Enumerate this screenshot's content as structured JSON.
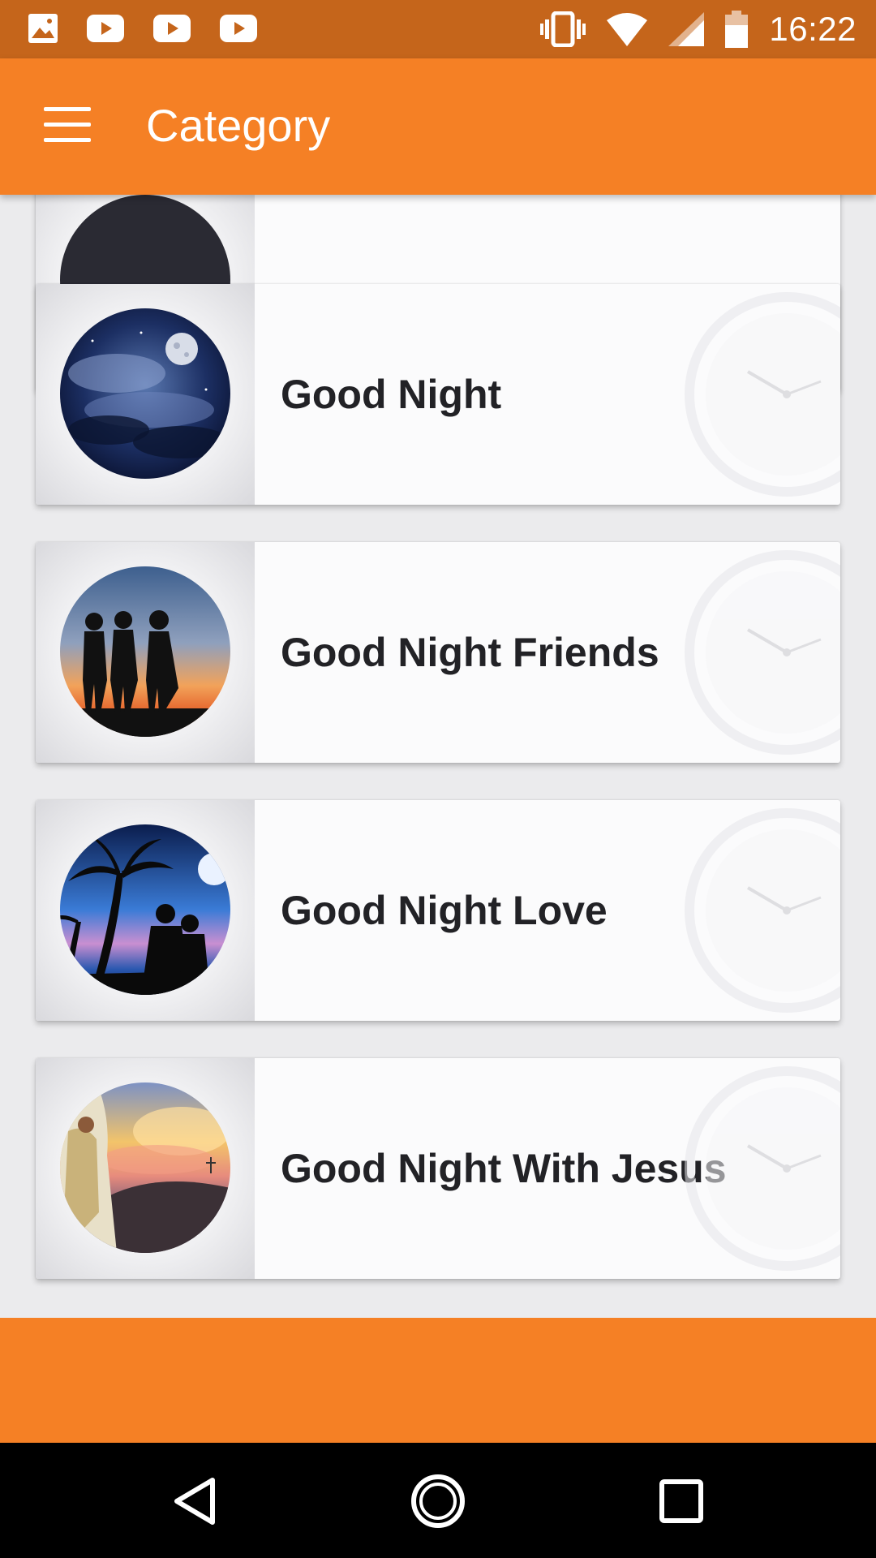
{
  "status_bar": {
    "time": "16:22",
    "left_icons": [
      "image-notification-icon",
      "youtube-icon",
      "youtube-icon",
      "youtube-icon"
    ],
    "right_icons": [
      "vibrate-icon",
      "wifi-icon",
      "cell-signal-icon",
      "battery-icon"
    ]
  },
  "app_bar": {
    "title": "Category",
    "menu_icon": "hamburger-menu-icon",
    "color": "#f58025"
  },
  "categories": [
    {
      "label": ""
    },
    {
      "label": "Good Night"
    },
    {
      "label": "Good Night Friends"
    },
    {
      "label": "Good Night Love"
    },
    {
      "label": "Good Night With Jesus"
    }
  ],
  "colors": {
    "accent": "#f58025",
    "status_bar": "#c5651b",
    "background": "#ebebed",
    "card": "#fbfbfc",
    "text": "#222226"
  },
  "nav_bar": {
    "back": "back-icon",
    "home": "home-icon",
    "recents": "recents-icon"
  }
}
